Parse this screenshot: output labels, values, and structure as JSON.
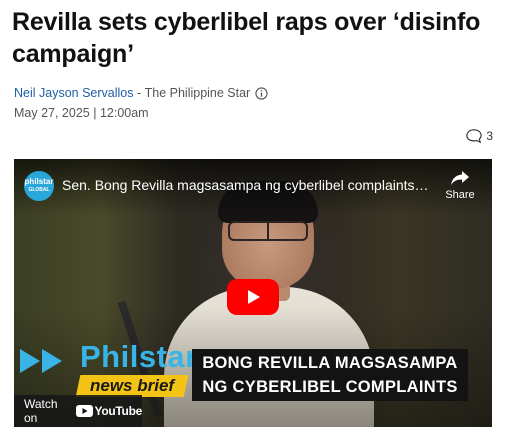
{
  "article": {
    "headline": "Revilla sets cyberlibel raps over ‘disinfo campaign’",
    "author": "Neil Jayson Servallos",
    "separator": " - ",
    "source": "The Philippine Star",
    "date": "May 27, 2025 | 12:00am",
    "comment_count": "3"
  },
  "video": {
    "channel_logo_line1": "philstar",
    "channel_logo_line2": "GLOBAL",
    "title": "Sen. Bong Revilla magsasampa ng cyberlibel complaints da...",
    "share_label": "Share",
    "brand_name": "Philstar",
    "brand_sub": "news brief",
    "lower_third_line1": "BONG REVILLA MAGSASAMPA",
    "lower_third_line2": "NG CYBERLIBEL COMPLAINTS",
    "watch_on_label": "Watch on",
    "youtube_label": "YouTube"
  },
  "icons": {
    "info": "info-icon",
    "comment": "comment-icon",
    "share": "share-icon",
    "play": "play-icon",
    "youtube": "youtube-logo-icon"
  },
  "colors": {
    "author_link": "#1f5fa8",
    "play_button": "#ff0000",
    "brand_blue": "#38b4e6",
    "brand_yellow": "#f3c316"
  }
}
